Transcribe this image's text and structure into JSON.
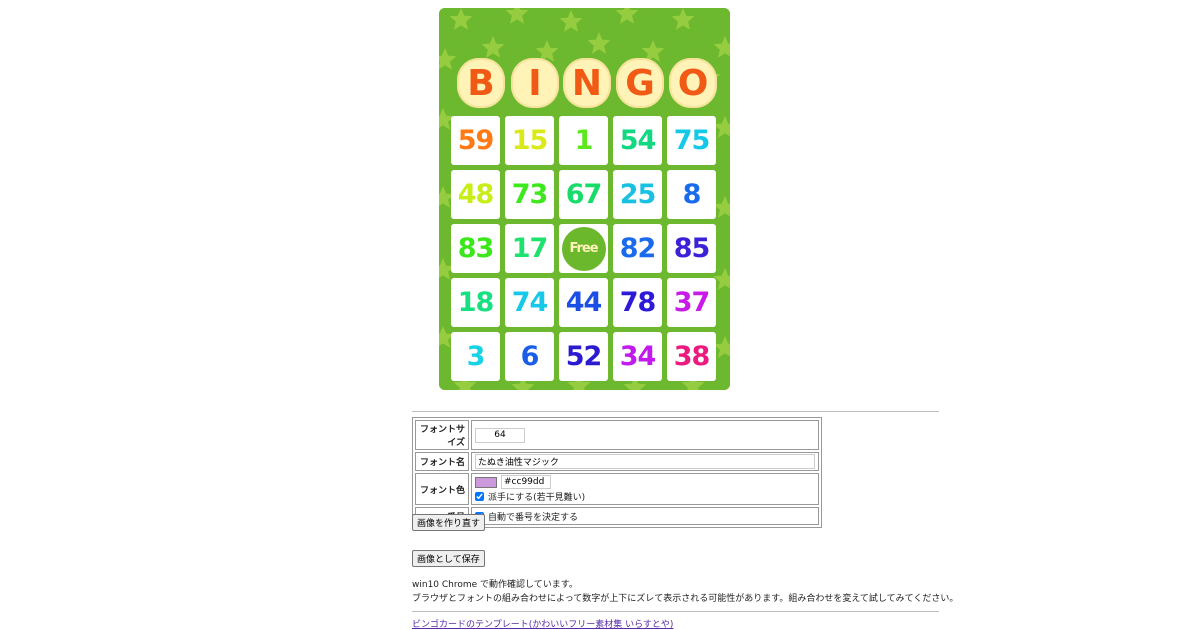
{
  "bingo_card": {
    "title_letters": [
      "B",
      "I",
      "N",
      "G",
      "O"
    ],
    "free_label": "Free",
    "rows": [
      [
        {
          "n": "59",
          "c": "#ff7a14"
        },
        {
          "n": "15",
          "c": "#d9ea18"
        },
        {
          "n": "1",
          "c": "#5ee81c"
        },
        {
          "n": "54",
          "c": "#12d882"
        },
        {
          "n": "75",
          "c": "#14c8e8"
        }
      ],
      [
        {
          "n": "48",
          "c": "#c8ee1a"
        },
        {
          "n": "73",
          "c": "#3ee81c"
        },
        {
          "n": "67",
          "c": "#18dc6a"
        },
        {
          "n": "25",
          "c": "#18c0e2"
        },
        {
          "n": "8",
          "c": "#1a6aec"
        }
      ],
      [
        {
          "n": "83",
          "c": "#3ae81a"
        },
        {
          "n": "17",
          "c": "#1ee26e"
        },
        null,
        {
          "n": "82",
          "c": "#1a6aec"
        },
        {
          "n": "85",
          "c": "#3b22d8"
        }
      ],
      [
        {
          "n": "18",
          "c": "#16e082"
        },
        {
          "n": "74",
          "c": "#18c8e8"
        },
        {
          "n": "44",
          "c": "#1a4ee4"
        },
        {
          "n": "78",
          "c": "#2c1ad8"
        },
        {
          "n": "37",
          "c": "#c81ae8"
        }
      ],
      [
        {
          "n": "3",
          "c": "#18d2e6"
        },
        {
          "n": "6",
          "c": "#1a5ee8"
        },
        {
          "n": "52",
          "c": "#2c1ad0"
        },
        {
          "n": "34",
          "c": "#c21aec"
        },
        {
          "n": "38",
          "c": "#ec1a7e"
        }
      ]
    ],
    "colors": {
      "background": "#6bb82c",
      "title_letter": "#f05a14",
      "title_badge": "#fff3b8"
    }
  },
  "settings": {
    "font_size": {
      "label": "フォントサイズ",
      "value": "64"
    },
    "font_name": {
      "label": "フォント名",
      "value": "たぬき油性マジック"
    },
    "font_color": {
      "label": "フォント色",
      "hex": "#cc99dd",
      "swatch": "#cc99dd",
      "fancy_label": "派手にする(若干見難い)",
      "fancy_checked": true
    },
    "number": {
      "label": "番号",
      "auto_label": "自動で番号を決定する",
      "auto_checked": true
    }
  },
  "buttons": {
    "regenerate": "画像を作り直す",
    "save": "画像として保存"
  },
  "notes": {
    "tested": "win10 Chrome で動作確認しています。",
    "warning": "ブラウザとフォントの組み合わせによって数字が上下にズレて表示される可能性があります。組み合わせを変えて試してみてください。"
  },
  "footer_link": "ビンゴカードのテンプレート(かわいいフリー素材集 いらすとや)"
}
